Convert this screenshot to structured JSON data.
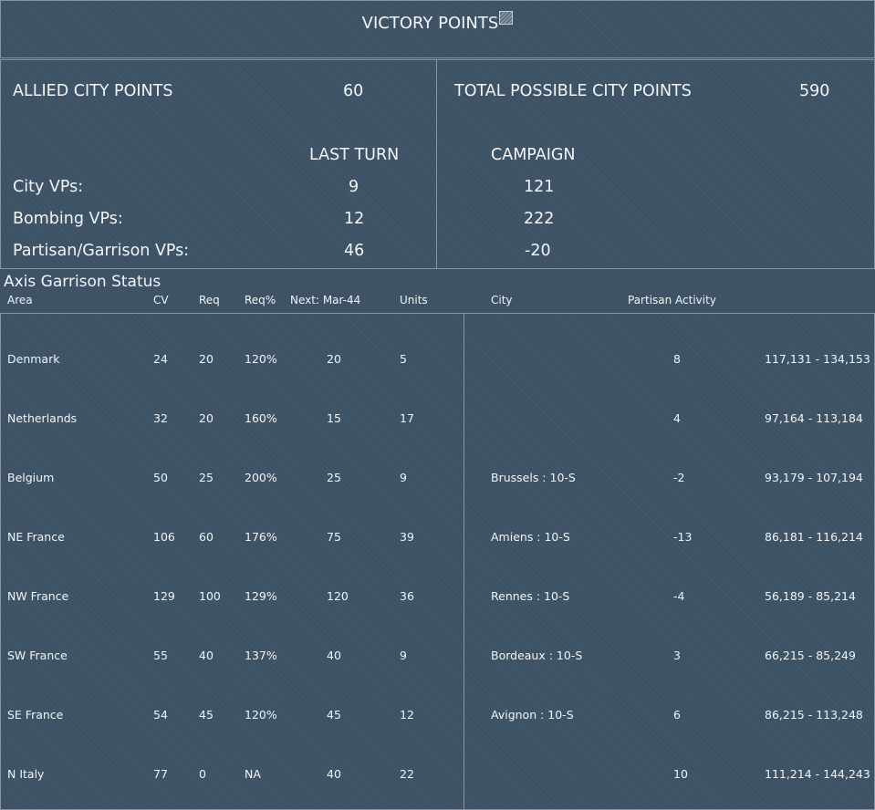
{
  "title": "VICTORY POINTS",
  "title_icon": "chart-icon",
  "summary": {
    "allied_city_points_label": "ALLIED CITY POINTS",
    "allied_city_points_value": "60",
    "total_possible_label": "TOTAL POSSIBLE CITY POINTS",
    "total_possible_value": "590",
    "last_turn_header": "LAST TURN",
    "campaign_header": "CAMPAIGN",
    "rows": [
      {
        "label": "City VPs:",
        "last_turn": "9",
        "campaign": "121"
      },
      {
        "label": "Bombing VPs:",
        "last_turn": "12",
        "campaign": "222"
      },
      {
        "label": "Partisan/Garrison VPs:",
        "last_turn": "46",
        "campaign": "-20"
      }
    ]
  },
  "garrison": {
    "section_title": "Axis Garrison Status",
    "headers": {
      "area": "Area",
      "cv": "CV",
      "req": "Req",
      "req_pct": "Req%",
      "next": "Next: Mar-44",
      "units": "Units",
      "city": "City",
      "partisan": "Partisan Activity"
    },
    "rows": [
      {
        "area": "Denmark",
        "cv": "24",
        "req": "20",
        "req_pct": "120%",
        "next": "20",
        "units": "5",
        "city": "",
        "partisan": "8",
        "range": "117,131 - 134,153"
      },
      {
        "area": "Netherlands",
        "cv": "32",
        "req": "20",
        "req_pct": "160%",
        "next": "15",
        "units": "17",
        "city": "",
        "partisan": "4",
        "range": "97,164 - 113,184"
      },
      {
        "area": "Belgium",
        "cv": "50",
        "req": "25",
        "req_pct": "200%",
        "next": "25",
        "units": "9",
        "city": "Brussels : 10-S",
        "partisan": "-2",
        "range": "93,179 - 107,194"
      },
      {
        "area": "NE France",
        "cv": "106",
        "req": "60",
        "req_pct": "176%",
        "next": "75",
        "units": "39",
        "city": "Amiens : 10-S",
        "partisan": "-13",
        "range": "86,181 - 116,214"
      },
      {
        "area": "NW France",
        "cv": "129",
        "req": "100",
        "req_pct": "129%",
        "next": "120",
        "units": "36",
        "city": "Rennes : 10-S",
        "partisan": "-4",
        "range": "56,189 - 85,214"
      },
      {
        "area": "SW France",
        "cv": "55",
        "req": "40",
        "req_pct": "137%",
        "next": "40",
        "units": "9",
        "city": "Bordeaux : 10-S",
        "partisan": "3",
        "range": "66,215 - 85,249"
      },
      {
        "area": "SE France",
        "cv": "54",
        "req": "45",
        "req_pct": "120%",
        "next": "45",
        "units": "12",
        "city": "Avignon : 10-S",
        "partisan": "6",
        "range": "86,215 - 113,248"
      },
      {
        "area": "N Italy",
        "cv": "77",
        "req": "0",
        "req_pct": "NA",
        "next": "40",
        "units": "22",
        "city": "",
        "partisan": "10",
        "range": "111,214 - 144,243"
      }
    ]
  }
}
